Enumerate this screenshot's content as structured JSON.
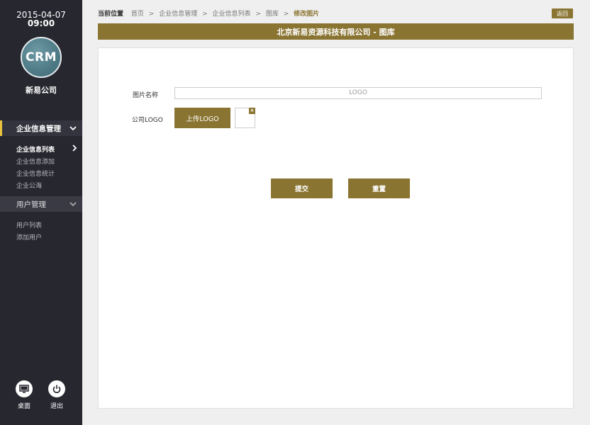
{
  "sidebar": {
    "date": "2015-04-07",
    "time": "09:00",
    "avatar_text": "CRM",
    "company": "新易公司",
    "menu_enterprise": "企业信息管理",
    "enterprise_items": [
      "企业信息列表",
      "企业信息添加",
      "企业信息统计",
      "企业公海"
    ],
    "menu_user": "用户管理",
    "user_items": [
      "用户列表",
      "添加用户"
    ],
    "desktop_label": "桌面",
    "logout_label": "退出",
    "accent_color": "#e8c33d"
  },
  "breadcrumb": {
    "title": "当前位置",
    "items": [
      "首页",
      "企业信息管理",
      "企业信息列表",
      "图库"
    ],
    "current": "修改图片",
    "separator": ">"
  },
  "back_label": "返回",
  "page_title": "北京新易资源科技有限公司 - 图库",
  "form": {
    "image_name_label": "图片名称",
    "image_name_value": "LOGO",
    "logo_label": "公司LOGO",
    "upload_label": "上传LOGO",
    "remove_glyph": "×",
    "submit_label": "提交",
    "reset_label": "重置"
  },
  "colors": {
    "brand": "#8a7431",
    "sidebar_bg": "#272730"
  }
}
